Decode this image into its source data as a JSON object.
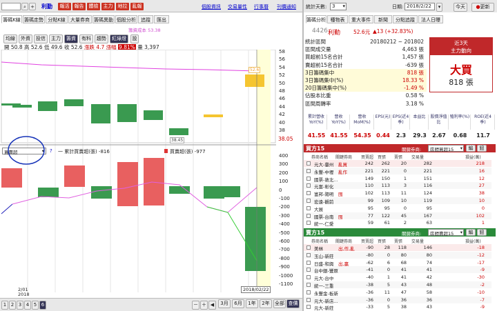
{
  "top": {
    "stock": "利勤",
    "stock_box": "",
    "buttons": [
      "報活",
      "報告",
      "體檢",
      "主力",
      "地拉",
      "亂報"
    ],
    "links": [
      "個股資訊",
      "交易量性",
      "行事曆",
      "刊價通知"
    ]
  },
  "left_tabs": [
    "籌碼K線",
    "籌碼走勢",
    "分點K線",
    "大量券商",
    "籌碼異動",
    "個股分析",
    "追蹤",
    "匯出"
  ],
  "legend_small": "籌資成本 53.38",
  "toolbar": [
    "均線",
    "外資",
    "投信",
    "主力",
    "籌資",
    "有料",
    "趨勢",
    "紅綠燈"
  ],
  "toolbar_plus": "設",
  "ohlc": {
    "o_label": "開",
    "o": "50.8",
    "h_label": "高",
    "h": "52.6",
    "l_label": "低",
    "l": "49.6",
    "c_label": "收",
    "c": "52.6",
    "chg_label": "漲跌",
    "chg": "4.7",
    "pct_label": "漲幅",
    "pct": "9.81%",
    "v_label": "量",
    "v": "3,397"
  },
  "price_axis": [
    "58",
    "56",
    "54",
    "52",
    "50",
    "48",
    "46",
    "44",
    "42",
    "40",
    "38"
  ],
  "last_price": "38.05",
  "cost_tag": "52.6",
  "low_tag": "38.45",
  "lower": {
    "select": "買賣超",
    "hint": "?",
    "l1": "一 累計買賣超(張) -816",
    "l2": "買賣超(張) -977"
  },
  "vol_axis": [
    "400",
    "300",
    "200",
    "100",
    "0",
    "-100",
    "-200",
    "-300",
    "-400",
    "-500",
    "-600",
    "-700",
    "-800",
    "-900",
    "-1000",
    "-1100"
  ],
  "date_left": "2/01",
  "year": "2018",
  "date_box": "2018/02/22",
  "bottom_pages": [
    "1",
    "2",
    "3",
    "4",
    "5",
    "6"
  ],
  "range_btns": [
    "3月",
    "6月",
    "1年",
    "2年",
    "全部",
    "查價"
  ],
  "right": {
    "days_label": "統計天數:",
    "days": "3",
    "date_label": "日期:",
    "date": "2018/2/22",
    "today": "今天",
    "refresh": "更新",
    "tabs": [
      "籌碼分析",
      "種物表",
      "重大事件",
      "新聞",
      "分點追蹤",
      "法人日曝"
    ],
    "code": "4426",
    "name": "利勤",
    "price": "52.6元",
    "chg": "▲13 (+32.83%)",
    "stats": [
      {
        "k": "統計區間",
        "v": "20180212 ~ 201802"
      },
      {
        "k": "區間成交量",
        "v": "4,463 張"
      },
      {
        "k": "買超前15名合計",
        "v": "1,457 張"
      },
      {
        "k": "賣超前15名合計",
        "v": "-639 張"
      },
      {
        "k": "3日籌碼集中",
        "v": "818 張"
      },
      {
        "k": "3日籌碼集中(%)",
        "v": "18.33 %"
      },
      {
        "k": "20日籌碼集中(%)",
        "v": "-1.49 %"
      },
      {
        "k": "佔股本比重",
        "v": "0.58 %"
      },
      {
        "k": "區間周轉率",
        "v": "3.18 %"
      }
    ],
    "box_title": "近3天",
    "box_sub": "主力動向",
    "box_big": "大買",
    "box_val": "818 張",
    "metrics_h": [
      "累計營收YoY(%)",
      "營收YoY(%)",
      "營收MoM(%)",
      "EPS(元)",
      "EPS(近4季)",
      "本益比",
      "股價淨值比",
      "殖利率(%)",
      "ROE(近4季)"
    ],
    "metrics_v": [
      "41.55",
      "41.55",
      "54.35",
      "0.44",
      "2.3",
      "29.3",
      "2.67",
      "0.68",
      "11.7"
    ],
    "buy_title": "買方15",
    "key_label": "關鍵券商:",
    "key_sel": "區間買超15",
    "b_edit": "編",
    "b_set": "鈕",
    "cols": [
      "券商名稱",
      "關鍵券商",
      "買賣超",
      "買張",
      "賣張",
      "交易量",
      "損益(萬)"
    ],
    "buy_rows": [
      [
        "元大-臺州",
        "亂買",
        "242",
        "262",
        "20",
        "282",
        "218"
      ],
      [
        "永豐-中壢",
        "亂作",
        "221",
        "221",
        "0",
        "221",
        "16"
      ],
      [
        "國票-敦北...",
        "",
        "149",
        "150",
        "1",
        "151",
        "12"
      ],
      [
        "元富-彰化",
        "",
        "110",
        "113",
        "3",
        "116",
        "27"
      ],
      [
        "富邦-陽明",
        "囤",
        "102",
        "113",
        "11",
        "124",
        "38"
      ],
      [
        "宏遠-觀前",
        "",
        "99",
        "109",
        "10",
        "119",
        "10"
      ],
      [
        "大展",
        "",
        "95",
        "95",
        "0",
        "95",
        "0"
      ],
      [
        "國票-台南",
        "囤",
        "77",
        "122",
        "45",
        "167",
        "102"
      ],
      [
        "統一-仁愛",
        "",
        "59",
        "61",
        "2",
        "63",
        "1"
      ]
    ],
    "sell_title": "賣方15",
    "sell_sel": "區間賣超15",
    "sell_rows": [
      [
        "美林",
        "出,作,亂",
        "-90",
        "28",
        "118",
        "146",
        "-18"
      ],
      [
        "玉山-新莊",
        "",
        "-80",
        "0",
        "80",
        "80",
        "-12"
      ],
      [
        "日盛-和興",
        "出,贏",
        "-62",
        "6",
        "68",
        "74",
        "-17"
      ],
      [
        "台中銀-豐原",
        "",
        "-41",
        "0",
        "41",
        "41",
        "-9"
      ],
      [
        "元大-台中",
        "",
        "-40",
        "1",
        "41",
        "42",
        "-30"
      ],
      [
        "統一-三重",
        "",
        "-38",
        "5",
        "43",
        "48",
        "-2"
      ],
      [
        "永豐金-板新",
        "",
        "-36",
        "11",
        "47",
        "58",
        "-10"
      ],
      [
        "元大-新店...",
        "",
        "-36",
        "0",
        "36",
        "36",
        "-7"
      ],
      [
        "元大-新莊",
        "",
        "-33",
        "5",
        "38",
        "43",
        "-9"
      ]
    ]
  },
  "colors": {
    "up": "#e86060",
    "down": "#3a9a50",
    "accent": "#c0282a",
    "ma": "#e040e0"
  }
}
